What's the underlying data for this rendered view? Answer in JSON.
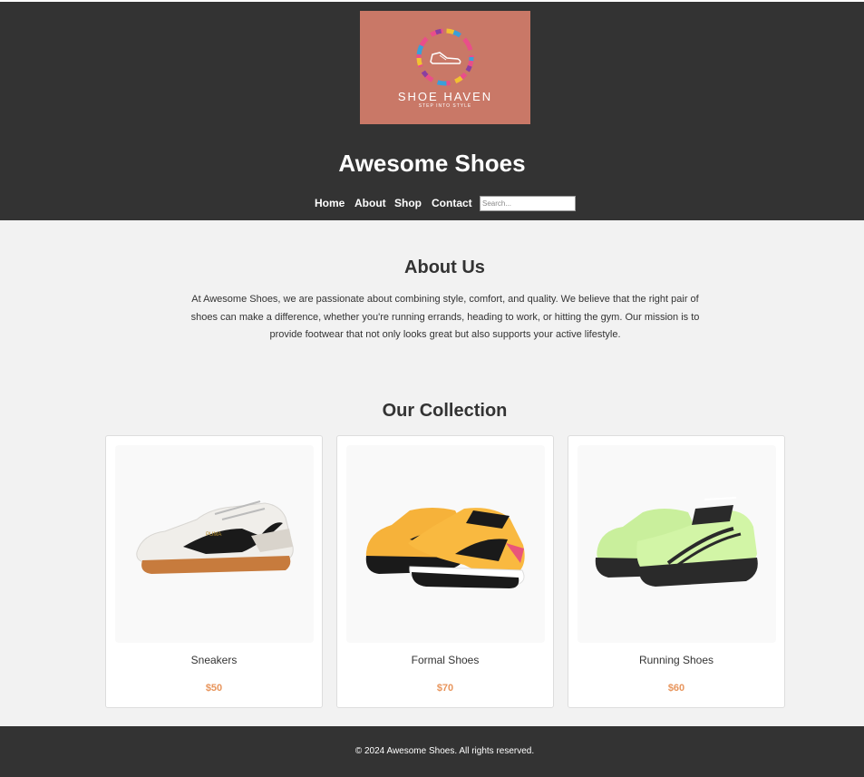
{
  "logo": {
    "name": "SHOE HAVEN",
    "tagline": "STEP INTO STYLE"
  },
  "header": {
    "title": "Awesome Shoes"
  },
  "nav": {
    "items": [
      {
        "label": "Home"
      },
      {
        "label": "About"
      },
      {
        "label": "Shop"
      },
      {
        "label": "Contact"
      }
    ],
    "search_placeholder": "Search..."
  },
  "about": {
    "title": "About Us",
    "text": "At Awesome Shoes, we are passionate about combining style, comfort, and quality. We believe that the right pair of shoes can make a difference, whether you're running errands, heading to work, or hitting the gym. Our mission is to provide footwear that not only looks great but also supports your active lifestyle."
  },
  "collection": {
    "title": "Our Collection",
    "products": [
      {
        "name": "Sneakers",
        "price": "$50",
        "image_icon": "sneaker-white-black-icon"
      },
      {
        "name": "Formal Shoes",
        "price": "$70",
        "image_icon": "sneaker-orange-black-icon"
      },
      {
        "name": "Running Shoes",
        "price": "$60",
        "image_icon": "sneaker-lime-green-icon"
      }
    ]
  },
  "footer": {
    "copyright": "© 2024 Awesome Shoes. All rights reserved."
  },
  "colors": {
    "header_bg": "#333333",
    "page_bg": "#f2f2f2",
    "logo_bg": "#c97867",
    "price": "#e8955c"
  }
}
